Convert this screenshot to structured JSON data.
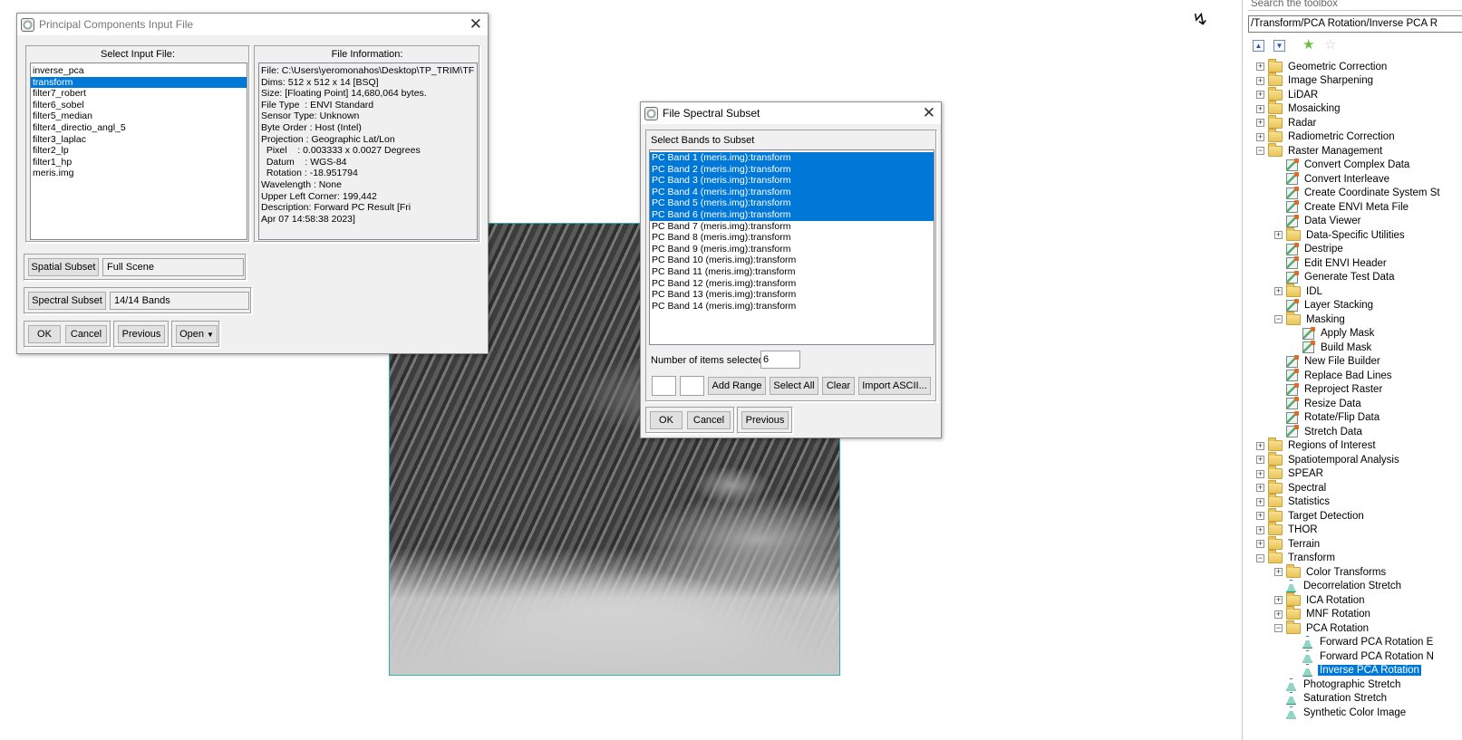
{
  "pca_dialog": {
    "title": "Principal Components Input File",
    "select_label": "Select Input File:",
    "files": [
      "inverse_pca",
      "transform",
      "filter7_robert",
      "filter6_sobel",
      "filter5_median",
      "filter4_directio_angl_5",
      "filter3_laplac",
      "filter2_lp",
      "filter1_hp",
      "meris.img"
    ],
    "selected_file": "transform",
    "info_title": "File Information:",
    "info_lines": [
      "File: C:\\Users\\yeromonahos\\Desktop\\TP_TRIM\\TF",
      "Dims: 512 x 512 x 14 [BSQ]",
      "Size: [Floating Point] 14,680,064 bytes.",
      "File Type  : ENVI Standard",
      "Sensor Type: Unknown",
      "Byte Order : Host (Intel)",
      "Projection : Geographic Lat/Lon",
      "  Pixel    : 0.003333 x 0.0027 Degrees",
      "  Datum    : WGS-84",
      "  Rotation : -18.951794",
      "Wavelength : None",
      "Upper Left Corner: 199,442",
      "Description: Forward PC Result [Fri",
      "Apr 07 14:58:38 2023]"
    ],
    "spatial_subset_label": "Spatial Subset",
    "spatial_subset_value": "Full Scene",
    "spectral_subset_label": "Spectral Subset",
    "spectral_subset_value": "14/14 Bands",
    "ok_label": "OK",
    "cancel_label": "Cancel",
    "previous_label": "Previous",
    "open_label": "Open"
  },
  "spectral_dialog": {
    "title": "File Spectral Subset",
    "select_label": "Select Bands to Subset",
    "bands": [
      {
        "label": "PC Band 1 (meris.img):transform",
        "selected": true
      },
      {
        "label": "PC Band 2 (meris.img):transform",
        "selected": true
      },
      {
        "label": "PC Band 3 (meris.img):transform",
        "selected": true
      },
      {
        "label": "PC Band 4 (meris.img):transform",
        "selected": true
      },
      {
        "label": "PC Band 5 (meris.img):transform",
        "selected": true
      },
      {
        "label": "PC Band 6 (meris.img):transform",
        "selected": true
      },
      {
        "label": "PC Band 7 (meris.img):transform",
        "selected": false
      },
      {
        "label": "PC Band 8 (meris.img):transform",
        "selected": false
      },
      {
        "label": "PC Band 9 (meris.img):transform",
        "selected": false
      },
      {
        "label": "PC Band 10 (meris.img):transform",
        "selected": false
      },
      {
        "label": "PC Band 11 (meris.img):transform",
        "selected": false
      },
      {
        "label": "PC Band 12 (meris.img):transform",
        "selected": false
      },
      {
        "label": "PC Band 13 (meris.img):transform",
        "selected": false
      },
      {
        "label": "PC Band 14 (meris.img):transform",
        "selected": false
      }
    ],
    "count_label": "Number of items selected:",
    "count_value": "6",
    "range_from": "",
    "range_to": "",
    "add_range_label": "Add Range",
    "select_all_label": "Select All",
    "clear_label": "Clear",
    "import_label": "Import ASCII...",
    "ok_label": "OK",
    "cancel_label": "Cancel",
    "previous_label": "Previous"
  },
  "toolbox": {
    "search_placeholder": "Search the toolbox",
    "path": "/Transform/PCA Rotation/Inverse PCA R",
    "items": [
      {
        "label": "Geometric Correction",
        "level": 0,
        "kind": "folder",
        "expander": "plus"
      },
      {
        "label": "Image Sharpening",
        "level": 0,
        "kind": "folder",
        "expander": "plus"
      },
      {
        "label": "LiDAR",
        "level": 0,
        "kind": "folder",
        "expander": "plus"
      },
      {
        "label": "Mosaicking",
        "level": 0,
        "kind": "folder",
        "expander": "plus"
      },
      {
        "label": "Radar",
        "level": 0,
        "kind": "folder",
        "expander": "plus"
      },
      {
        "label": "Radiometric Correction",
        "level": 0,
        "kind": "folder",
        "expander": "plus"
      },
      {
        "label": "Raster Management",
        "level": 0,
        "kind": "folder",
        "expander": "minus"
      },
      {
        "label": "Convert Complex Data",
        "level": 1,
        "kind": "tool",
        "expander": ""
      },
      {
        "label": "Convert Interleave",
        "level": 1,
        "kind": "tool",
        "expander": ""
      },
      {
        "label": "Create Coordinate System St",
        "level": 1,
        "kind": "tool",
        "expander": ""
      },
      {
        "label": "Create ENVI Meta File",
        "level": 1,
        "kind": "tool",
        "expander": ""
      },
      {
        "label": "Data Viewer",
        "level": 1,
        "kind": "tool",
        "expander": ""
      },
      {
        "label": "Data-Specific Utilities",
        "level": 1,
        "kind": "folder",
        "expander": "plus"
      },
      {
        "label": "Destripe",
        "level": 1,
        "kind": "tool",
        "expander": ""
      },
      {
        "label": "Edit ENVI Header",
        "level": 1,
        "kind": "tool",
        "expander": ""
      },
      {
        "label": "Generate Test Data",
        "level": 1,
        "kind": "tool",
        "expander": ""
      },
      {
        "label": "IDL",
        "level": 1,
        "kind": "folder",
        "expander": "plus"
      },
      {
        "label": "Layer Stacking",
        "level": 1,
        "kind": "tool",
        "expander": ""
      },
      {
        "label": "Masking",
        "level": 1,
        "kind": "folder",
        "expander": "minus"
      },
      {
        "label": "Apply Mask",
        "level": 2,
        "kind": "tool",
        "expander": ""
      },
      {
        "label": "Build Mask",
        "level": 2,
        "kind": "tool",
        "expander": ""
      },
      {
        "label": "New File Builder",
        "level": 1,
        "kind": "tool",
        "expander": ""
      },
      {
        "label": "Replace Bad Lines",
        "level": 1,
        "kind": "tool",
        "expander": ""
      },
      {
        "label": "Reproject Raster",
        "level": 1,
        "kind": "tool",
        "expander": ""
      },
      {
        "label": "Resize Data",
        "level": 1,
        "kind": "tool",
        "expander": ""
      },
      {
        "label": "Rotate/Flip Data",
        "level": 1,
        "kind": "tool",
        "expander": ""
      },
      {
        "label": "Stretch Data",
        "level": 1,
        "kind": "tool",
        "expander": ""
      },
      {
        "label": "Regions of Interest",
        "level": 0,
        "kind": "folder",
        "expander": "plus"
      },
      {
        "label": "Spatiotemporal Analysis",
        "level": 0,
        "kind": "folder",
        "expander": "plus"
      },
      {
        "label": "SPEAR",
        "level": 0,
        "kind": "folder",
        "expander": "plus"
      },
      {
        "label": "Spectral",
        "level": 0,
        "kind": "folder",
        "expander": "plus"
      },
      {
        "label": "Statistics",
        "level": 0,
        "kind": "folder",
        "expander": "plus"
      },
      {
        "label": "Target Detection",
        "level": 0,
        "kind": "folder",
        "expander": "plus"
      },
      {
        "label": "THOR",
        "level": 0,
        "kind": "folder",
        "expander": "plus"
      },
      {
        "label": "Terrain",
        "level": 0,
        "kind": "folder",
        "expander": "plus"
      },
      {
        "label": "Transform",
        "level": 0,
        "kind": "folder",
        "expander": "minus"
      },
      {
        "label": "Color Transforms",
        "level": 1,
        "kind": "folder",
        "expander": "plus"
      },
      {
        "label": "Decorrelation Stretch",
        "level": 1,
        "kind": "flask",
        "expander": ""
      },
      {
        "label": "ICA Rotation",
        "level": 1,
        "kind": "folder",
        "expander": "plus"
      },
      {
        "label": "MNF Rotation",
        "level": 1,
        "kind": "folder",
        "expander": "plus"
      },
      {
        "label": "PCA Rotation",
        "level": 1,
        "kind": "folder",
        "expander": "minus"
      },
      {
        "label": "Forward PCA Rotation E",
        "level": 2,
        "kind": "flask",
        "expander": ""
      },
      {
        "label": "Forward PCA Rotation N",
        "level": 2,
        "kind": "flask",
        "expander": ""
      },
      {
        "label": "Inverse PCA Rotation",
        "level": 2,
        "kind": "flask",
        "expander": "",
        "selected": true
      },
      {
        "label": "Photographic Stretch",
        "level": 1,
        "kind": "flask",
        "expander": ""
      },
      {
        "label": "Saturation Stretch",
        "level": 1,
        "kind": "flask",
        "expander": ""
      },
      {
        "label": "Synthetic Color Image",
        "level": 1,
        "kind": "flask",
        "expander": ""
      }
    ]
  }
}
